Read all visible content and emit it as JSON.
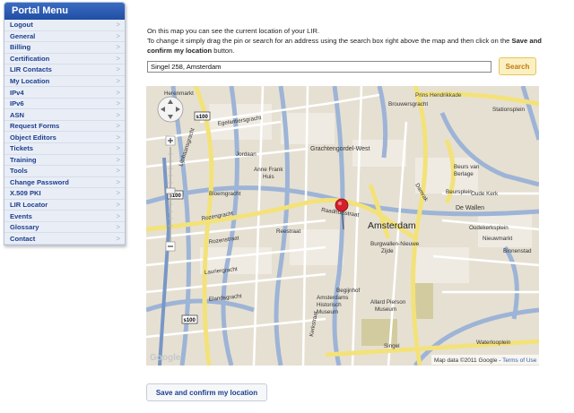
{
  "sidebar": {
    "title": "Portal Menu",
    "items": [
      "Logout",
      "General",
      "Billing",
      "Certification",
      "LIR Contacts",
      "My Location",
      "IPv4",
      "IPv6",
      "ASN",
      "Request Forms",
      "Object Editors",
      "Tickets",
      "Training",
      "Tools",
      "Change Password",
      "X.509 PKI",
      "LIR Locator",
      "Events",
      "Glossary",
      "Contact"
    ],
    "chevron": ">"
  },
  "intro": {
    "line1": "On this map you can see the current location of your LIR.",
    "line2a": "To change it simply drag the pin or search for an address using the search box right above the map and then click on the ",
    "line2b": "Save and confirm my location",
    "line2c": " button."
  },
  "search": {
    "value": "Singel 258, Amsterdam",
    "button": "Search"
  },
  "map": {
    "labels": {
      "herenmarkt": "Herenmarkt",
      "prins_hendrikkade": "Prins Hendrikkade",
      "brouwersgracht": "Brouwersgracht",
      "stationsplein": "Stationsplein",
      "jordaan": "Jordaan",
      "grachtengordel": "Grachtengordel-West",
      "anne_frank": "Anne Frank",
      "anne_frank2": "Huis",
      "beurs1": "Beurs van",
      "beurs2": "Berlage",
      "damrak": "Damrak",
      "beursplein": "Beursplein",
      "oude_kerk": "Oude Kerk",
      "de_wallen": "De Wallen",
      "amsterdam": "Amsterdam",
      "radhuisstraat": "Raadhuisstraat",
      "rozengracht": "Rozengracht",
      "bloemgracht": "Bloemgracht",
      "reestraat": "Reestraat",
      "burgwallen1": "Burgwallen-Nieuwe",
      "burgwallen2": "Zijde",
      "oudekerk": "Oudekerksplein",
      "nieuwmarkt": "Nieuwmarkt",
      "binnenstad": "Binnenstad",
      "begijnhof": "Begijnhof",
      "allard1": "Allard Pierson",
      "allard2": "Museum",
      "historisch1": "Amsterdams",
      "historisch2": "Historisch",
      "historisch3": "Museum",
      "singel": "Singel",
      "waterlooplein": "Waterlooplein",
      "lauriergracht": "Lauriergracht",
      "elandsgracht": "Elandsgracht",
      "kerkstraat": "Kerkstraat",
      "egelantiersgracht": "Egelantiersgracht",
      "rozenstraat": "Rozenstraat",
      "lijnbaansgracht": "Lijnbaansgracht",
      "s100": "s100",
      "google": "Google",
      "map_data": "Map data ©2011 Google - ",
      "terms": "Terms of Use"
    }
  },
  "confirm_button": "Save and confirm my location"
}
